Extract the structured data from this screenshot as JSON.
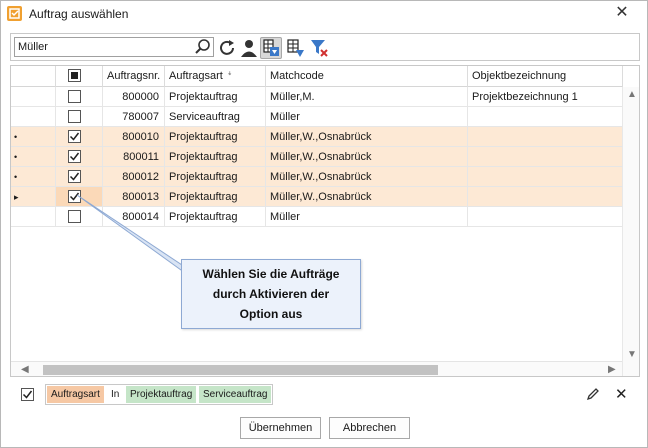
{
  "window": {
    "title": "Auftrag auswählen"
  },
  "search": {
    "value": "Müller"
  },
  "toolbar": {
    "icons": [
      "search-icon",
      "refresh-icon",
      "user-icon",
      "column-chooser-icon",
      "structure-icon",
      "clear-filter-icon"
    ]
  },
  "grid": {
    "columns": [
      "",
      "",
      "Auftragsnr.",
      "Auftragsart",
      "Matchcode",
      "Objektbezeichnung"
    ],
    "rows": [
      {
        "marker": "",
        "checked": false,
        "nr": "800000",
        "art": "Projektauftrag",
        "matchcode": "Müller,M.",
        "objekt": "Projektbezeichnung 1",
        "highlight": false
      },
      {
        "marker": "",
        "checked": false,
        "nr": "780007",
        "art": "Serviceauftrag",
        "matchcode": "Müller",
        "objekt": "",
        "highlight": false
      },
      {
        "marker": "•",
        "checked": true,
        "nr": "800010",
        "art": "Projektauftrag",
        "matchcode": "Müller,W.,Osnabrück",
        "objekt": "",
        "highlight": true
      },
      {
        "marker": "•",
        "checked": true,
        "nr": "800011",
        "art": "Projektauftrag",
        "matchcode": "Müller,W.,Osnabrück",
        "objekt": "",
        "highlight": true
      },
      {
        "marker": "•",
        "checked": true,
        "nr": "800012",
        "art": "Projektauftrag",
        "matchcode": "Müller,W.,Osnabrück",
        "objekt": "",
        "highlight": true
      },
      {
        "marker": "▸",
        "checked": true,
        "nr": "800013",
        "art": "Projektauftrag",
        "matchcode": "Müller,W.,Osnabrück",
        "objekt": "",
        "highlight": true
      },
      {
        "marker": "",
        "checked": false,
        "nr": "800014",
        "art": "Projektauftrag",
        "matchcode": "Müller",
        "objekt": "",
        "highlight": false
      }
    ]
  },
  "tooltip": {
    "line1": "Wählen Sie die Aufträge",
    "line2": "durch Aktivieren der",
    "line3": "Option aus"
  },
  "filter": {
    "enabled": true,
    "field": "Auftragsart",
    "operator": "In",
    "values": [
      "Projektauftrag",
      "Serviceauftrag"
    ]
  },
  "buttons": {
    "apply": "Übernehmen",
    "cancel": "Abbrechen"
  },
  "colors": {
    "highlight_row": "#fde9d5",
    "tooltip_bg": "#ecf2fb",
    "chip_orange": "#f6c8a4",
    "chip_green": "#c5e5c8"
  }
}
